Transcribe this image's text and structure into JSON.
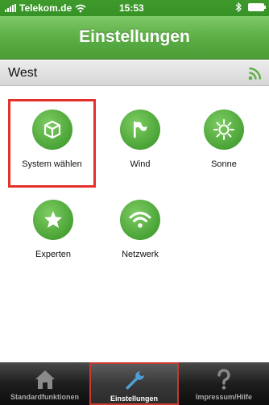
{
  "status_bar": {
    "carrier": "Telekom.de",
    "time": "15:53"
  },
  "nav": {
    "title": "Einstellungen"
  },
  "section": {
    "title": "West",
    "icon": "rss-icon"
  },
  "tiles": [
    {
      "label": "System wählen",
      "icon": "cube-icon",
      "selected": true
    },
    {
      "label": "Wind",
      "icon": "flag-icon",
      "selected": false
    },
    {
      "label": "Sonne",
      "icon": "sun-icon",
      "selected": false
    },
    {
      "label": "Experten",
      "icon": "star-icon",
      "selected": false
    },
    {
      "label": "Netzwerk",
      "icon": "wifi-icon",
      "selected": false
    }
  ],
  "tabs": [
    {
      "label": "Standardfunktionen",
      "icon": "home-icon",
      "active": false
    },
    {
      "label": "Einstellungen",
      "icon": "wrench-icon",
      "active": true
    },
    {
      "label": "Impressum/Hilfe",
      "icon": "question-icon",
      "active": false
    }
  ],
  "colors": {
    "accent_green": "#5cae45",
    "selection_red": "#e3322b"
  }
}
